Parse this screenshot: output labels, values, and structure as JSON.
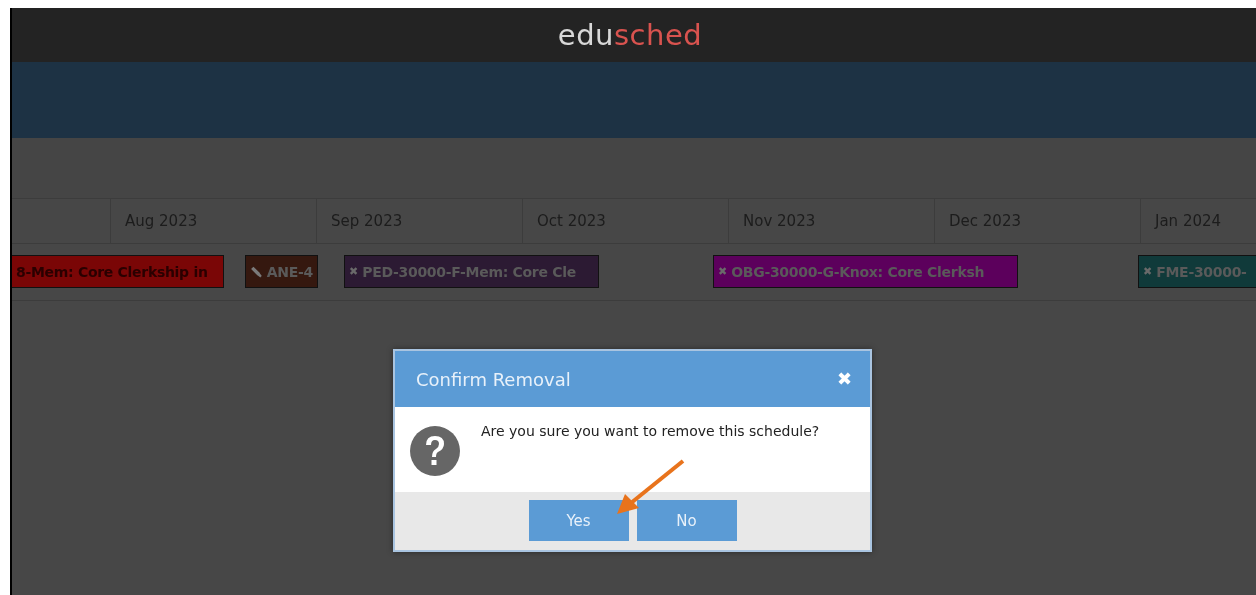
{
  "header": {
    "logo_left": "edu",
    "logo_right": "sched"
  },
  "timeline": {
    "months": [
      "Aug 2023",
      "Sep 2023",
      "Oct 2023",
      "Nov 2023",
      "Dec 2023",
      "Jan 2024"
    ],
    "schedules": [
      {
        "kind": "plain",
        "label": "8-Mem: Core Clerkship in",
        "color": "#7a0606"
      },
      {
        "kind": "tool",
        "label": "ANE-4",
        "color": "#35180f"
      },
      {
        "kind": "remove",
        "icon": "✖",
        "label": "PED-30000-F-Mem: Core Cle",
        "color": "#2c1a33"
      },
      {
        "kind": "remove",
        "icon": "✖",
        "label": "OBG-30000-G-Knox: Core Clerksh",
        "color": "#5c005c"
      },
      {
        "kind": "remove",
        "icon": "✖",
        "label": "FME-30000-",
        "color": "#103a3a"
      }
    ]
  },
  "dialog": {
    "title": "Confirm Removal",
    "close": "✖",
    "message": "Are you sure you want to remove this schedule?",
    "buttons": [
      "Yes",
      "No"
    ]
  }
}
